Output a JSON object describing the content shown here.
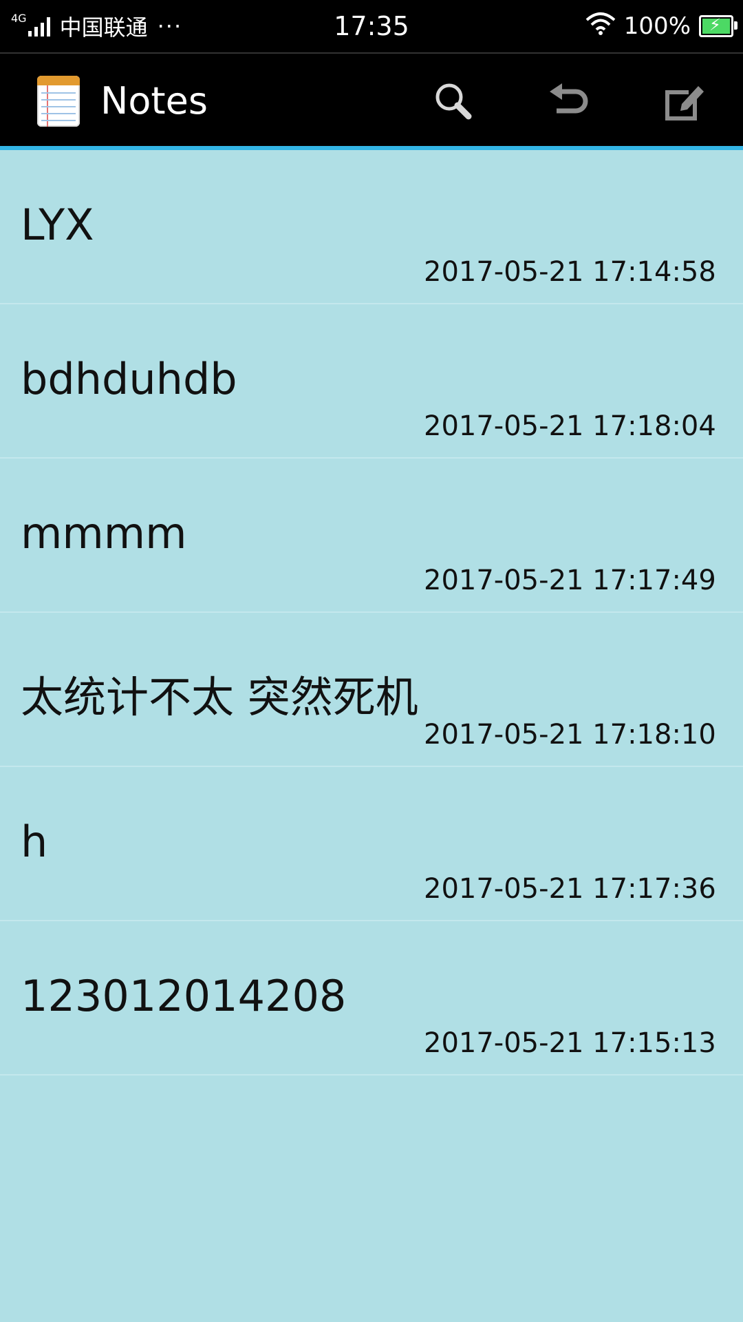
{
  "status_bar": {
    "network_type": "4G",
    "carrier": "中国联通",
    "more": "···",
    "time": "17:35",
    "battery_percent": "100%",
    "battery_level": 1.0
  },
  "action_bar": {
    "title": "Notes",
    "icons": [
      "app-notes-icon",
      "search-icon",
      "undo-icon",
      "compose-icon"
    ],
    "accent_color": "#33b5e5"
  },
  "notes": [
    {
      "title": "LYX",
      "time": "2017-05-21 17:14:58"
    },
    {
      "title": "bdhduhdb",
      "time": "2017-05-21 17:18:04"
    },
    {
      "title": "mmmm",
      "time": "2017-05-21 17:17:49"
    },
    {
      "title": "太统计不太 突然死机",
      "time": "2017-05-21 17:18:10"
    },
    {
      "title": "h",
      "time": "2017-05-21 17:17:36"
    },
    {
      "title": "123012014208",
      "time": "2017-05-21 17:15:13"
    }
  ],
  "colors": {
    "list_background": "#b0dfe5",
    "bar_background": "#000000"
  }
}
